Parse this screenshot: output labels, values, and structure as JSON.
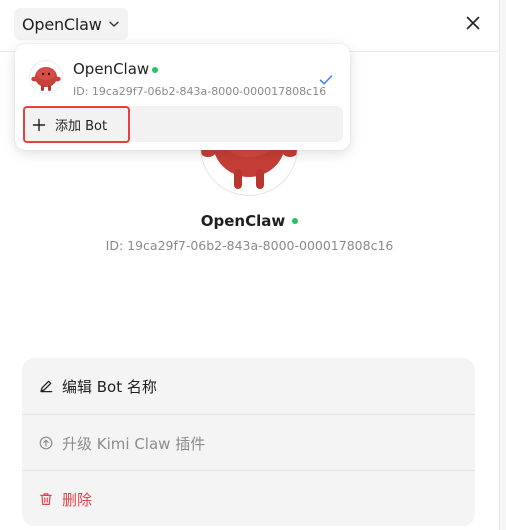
{
  "header": {
    "selected_bot": "OpenClaw",
    "icons": {
      "dropdown": "chevron-down-icon",
      "close": "close-icon"
    }
  },
  "profile": {
    "name": "OpenClaw",
    "id_label": "ID: 19ca29f7-06b2-843a-8000-000017808c16",
    "status_color": "#22c55e"
  },
  "dropdown": {
    "items": [
      {
        "name": "OpenClaw",
        "id_label": "ID: 19ca29f7-06b2-843a-8000-000017808c16",
        "selected": true
      }
    ],
    "add_label": "添加 Bot",
    "add_icon": "plus-icon",
    "check_color": "#3b82f6"
  },
  "actions": [
    {
      "label": "编辑 Bot 名称",
      "icon": "pencil-icon",
      "color": "#1f1f1f"
    },
    {
      "label": "升级 Kimi Claw 插件",
      "icon": "upgrade-circle-icon",
      "color": "#8c8c8c"
    },
    {
      "label": "删除",
      "icon": "trash-icon",
      "color": "#e0454b"
    }
  ],
  "colors": {
    "accent": "#3b82f6",
    "danger": "#e0454b",
    "status_online": "#22c55e",
    "highlight": "#e5413f"
  }
}
